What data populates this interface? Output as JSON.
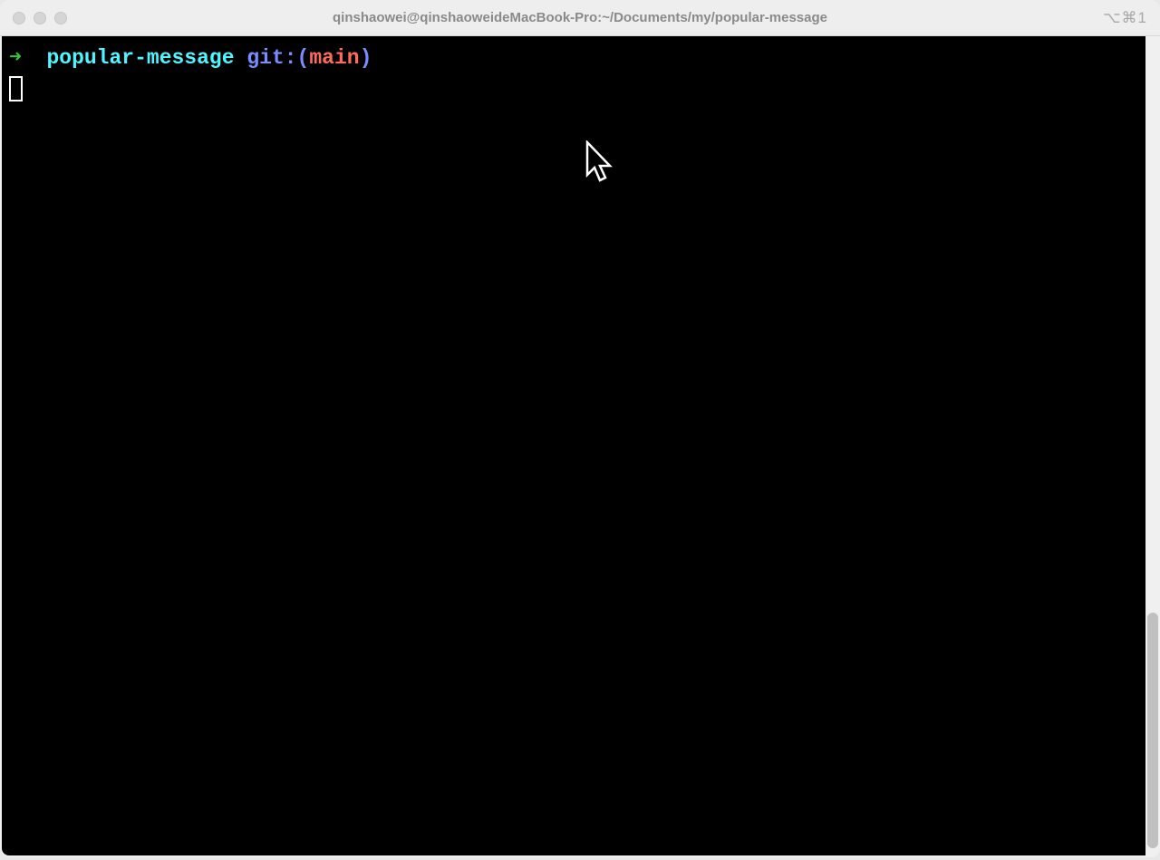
{
  "titlebar": {
    "title": "qinshaowei@qinshaoweideMacBook-Pro:~/Documents/my/popular-message",
    "shortcut": "⌥⌘1"
  },
  "prompt": {
    "arrow": "➜",
    "directory": "popular-message",
    "git_label": "git:",
    "paren_open": "(",
    "branch": "main",
    "paren_close": ")"
  }
}
